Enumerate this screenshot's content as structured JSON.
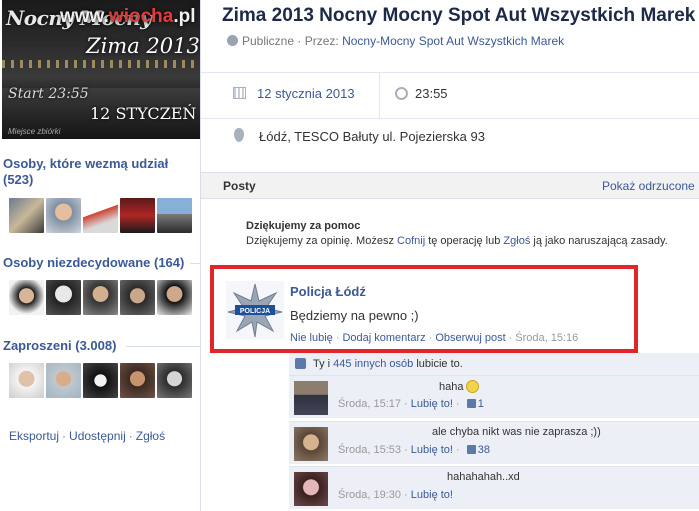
{
  "cover": {
    "watermark_prefix": "www.",
    "watermark_brand": "wiocha",
    "watermark_suffix": ".pl",
    "title_bg": "Nocny Mocny",
    "season": "Zima 2013",
    "start": "Start 23:55",
    "date": "12 STYCZEŃ",
    "caption": "Miejsce zbiórki"
  },
  "sidebar": {
    "attending_title": "Osoby, które wezmą udział (523)",
    "undecided_title": "Osoby niezdecydowane (164)",
    "invited_title": "Zaproszeni (3.008)",
    "actions": [
      "Eksportuj",
      "Udostępnij",
      "Zgłoś"
    ]
  },
  "event": {
    "title": "Zima 2013 Nocny Mocny Spot Aut Wszystkich Marek",
    "privacy": "Publiczne",
    "by_label": "Przez:",
    "organizer": "Nocny-Mocny Spot Aut Wszystkich Marek",
    "date": "12 stycznia 2013",
    "time": "23:55",
    "location": "Łódź, TESCO Bałuty ul. Pojezierska 93"
  },
  "posts": {
    "label": "Posty",
    "show_hidden": "Pokaż odrzucone"
  },
  "notice": {
    "title": "Dziękujemy za pomoc",
    "text_a": "Dziękujemy za opinię. Możesz ",
    "undo": "Cofnij",
    "text_b": " tę operację lub ",
    "report": "Zgłoś",
    "text_c": " ją jako naruszającą zasady."
  },
  "post": {
    "author": "Policja Łódź",
    "text": "Będziemy na pewno ;)",
    "unlike": "Nie lubię",
    "comment": "Dodaj komentarz",
    "follow": "Obserwuj post",
    "time": "Środa, 15:16",
    "badge_text": "POLICJA"
  },
  "likes": {
    "prefix": "Ty i ",
    "others": "445 innych osób",
    "suffix": " lubicie to."
  },
  "comments": [
    {
      "text": "haha",
      "time": "Środa, 15:17",
      "like": "Lubię to!",
      "count": "1"
    },
    {
      "text": "ale chyba nikt was nie zaprasza ;))",
      "time": "Środa, 15:53",
      "like": "Lubię to!",
      "count": "38"
    },
    {
      "text": "hahahahah..xd",
      "time": "Środa, 19:30",
      "like": "Lubię to!",
      "count": ""
    }
  ],
  "colors": {
    "link": "#3b5998",
    "highlight_border": "#e1252b",
    "comment_bg": "#eceff5"
  }
}
